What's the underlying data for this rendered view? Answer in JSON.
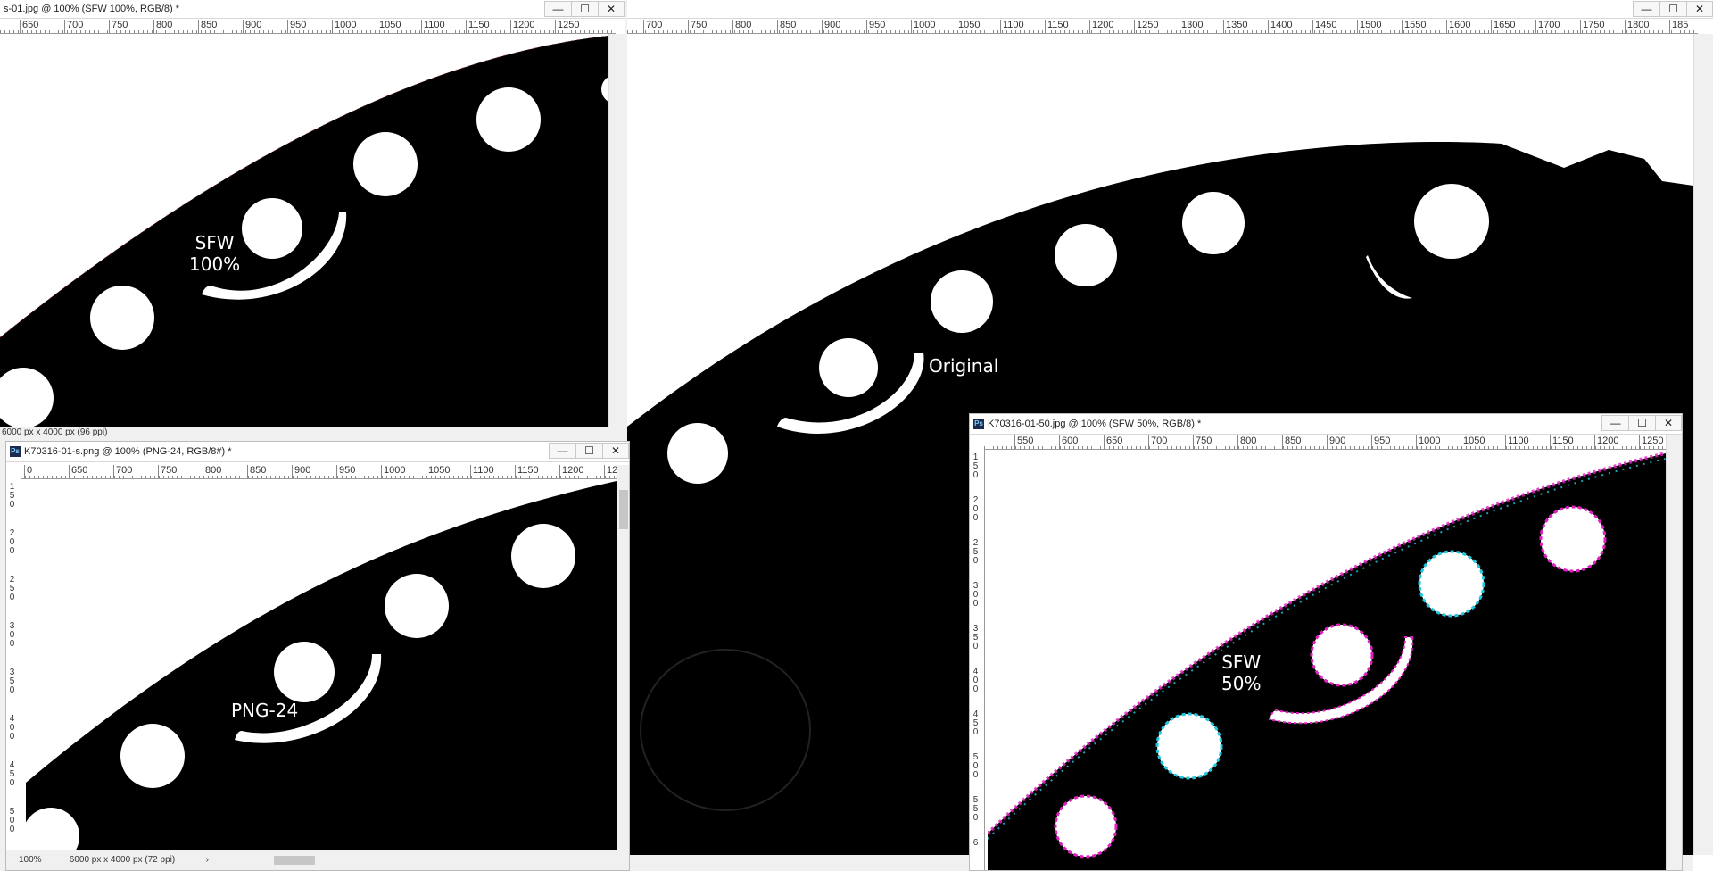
{
  "windows": {
    "sfw100": {
      "title": "s-01.jpg @ 100% (SFW 100%, RGB/8) *",
      "ruler_ticks": [
        "650",
        "700",
        "750",
        "800",
        "850",
        "900",
        "950",
        "1000",
        "1050",
        "1100",
        "1150",
        "1200",
        "1250"
      ],
      "status": "6000 px x 4000 px (96 ppi)",
      "overlay_label": "SFW\n100%"
    },
    "original": {
      "ruler_ticks": [
        "700",
        "750",
        "800",
        "850",
        "900",
        "950",
        "1000",
        "1050",
        "1100",
        "1150",
        "1200",
        "1250",
        "1300",
        "1350",
        "1400",
        "1450",
        "1500",
        "1550",
        "1600",
        "1650",
        "1700",
        "1750",
        "1800",
        "185"
      ],
      "overlay_label": "Original"
    },
    "png24": {
      "title": "K70316-01-s.png @ 100% (PNG-24, RGB/8#) *",
      "ruler_ticks": [
        "0",
        "650",
        "700",
        "750",
        "800",
        "850",
        "900",
        "950",
        "1000",
        "1050",
        "1100",
        "1150",
        "1200",
        "125"
      ],
      "vruler_ticks": [
        "150",
        "200",
        "250",
        "300",
        "350",
        "400",
        "450",
        "500",
        "55"
      ],
      "zoom": "100%",
      "status": "6000 px x 4000 px (72 ppi)",
      "overlay_label": "PNG-24"
    },
    "sfw50": {
      "title": "K70316-01-50.jpg @ 100% (SFW 50%, RGB/8) *",
      "ruler_ticks": [
        "550",
        "600",
        "650",
        "700",
        "750",
        "800",
        "850",
        "900",
        "950",
        "1000",
        "1050",
        "1100",
        "1150",
        "1200",
        "1250"
      ],
      "vruler_ticks": [
        "150",
        "200",
        "250",
        "300",
        "350",
        "400",
        "450",
        "500",
        "550",
        "6"
      ],
      "overlay_label": "SFW\n50%"
    }
  },
  "controls": {
    "minimize": "—",
    "maximize": "☐",
    "close": "✕"
  }
}
